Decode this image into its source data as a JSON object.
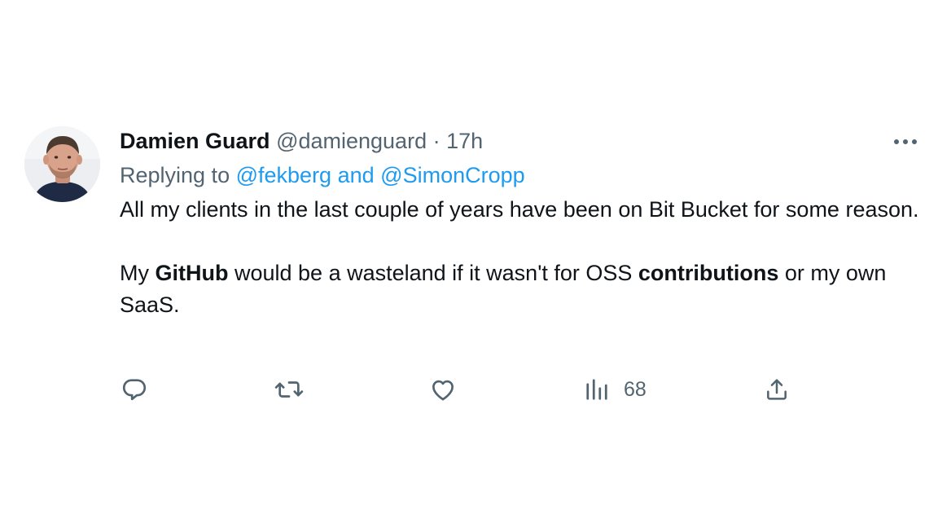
{
  "tweet": {
    "author": {
      "display_name": "Damien Guard",
      "handle": "@damienguard",
      "separator": "·",
      "time": "17h"
    },
    "reply": {
      "prefix": "Replying to",
      "mention_1": "@fekberg",
      "conjunction": "and",
      "mention_2": "@SimonCropp"
    },
    "body": {
      "p1": "All my clients in the last couple of years have been on Bit Bucket for some reason.",
      "p2_part1": "My ",
      "p2_bold1": "GitHub",
      "p2_part2": " would be a wasteland if it wasn't for OSS ",
      "p2_bold2": "contributions",
      "p2_part3": " or my own SaaS."
    },
    "actions": {
      "reply_icon": "reply-icon",
      "retweet_icon": "retweet-icon",
      "like_icon": "heart-icon",
      "views_icon": "analytics-icon",
      "views_count": "68",
      "share_icon": "share-icon"
    },
    "colors": {
      "text": "#0f1419",
      "secondary": "#536471",
      "link": "#1d9bf0"
    }
  }
}
